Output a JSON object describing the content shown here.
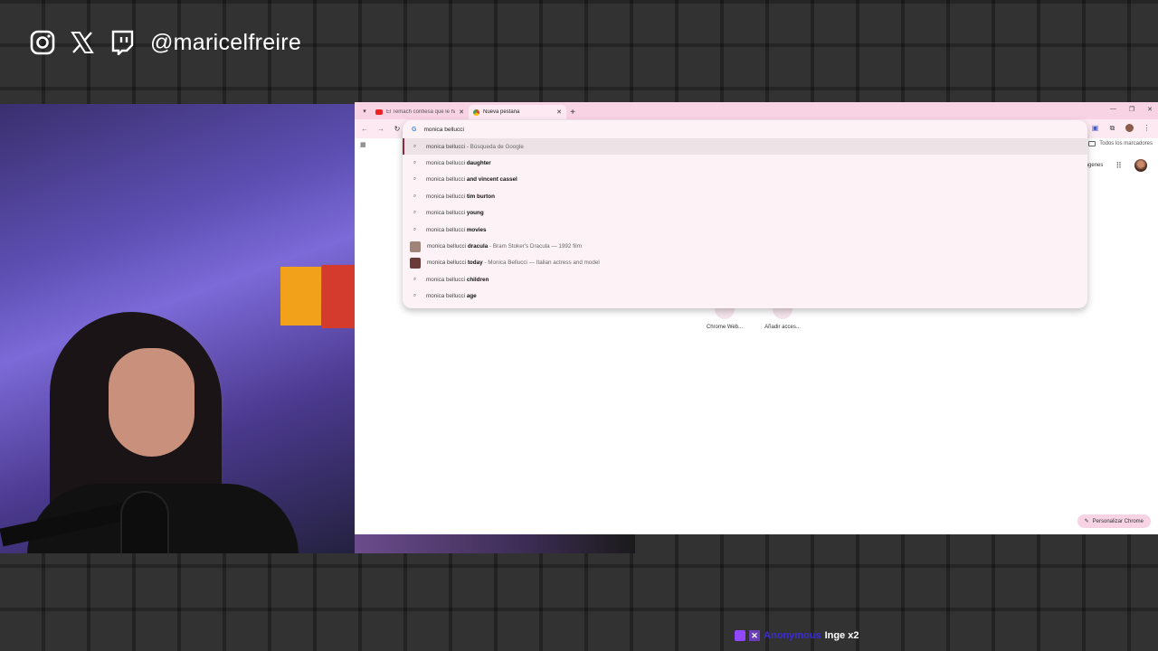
{
  "social": {
    "handle": "@maricelfreire",
    "icons": [
      "instagram-icon",
      "x-icon",
      "twitch-icon"
    ]
  },
  "browser": {
    "tabs": [
      {
        "title": "El Temach confiesa que le han...",
        "active": false
      },
      {
        "title": "Nueva pestaña",
        "active": true
      }
    ],
    "omnibox_value": "monica bellucci",
    "bookmarks_all": "Todos los marcadores",
    "images_link": "Imágenes",
    "suggestions": [
      {
        "base": "monica bellucci",
        "bold": "",
        "sub": " - Búsqueda de Google"
      },
      {
        "base": "monica bellucci ",
        "bold": "daughter",
        "sub": ""
      },
      {
        "base": "monica bellucci ",
        "bold": "and vincent cassel",
        "sub": ""
      },
      {
        "base": "monica bellucci ",
        "bold": "tim burton",
        "sub": ""
      },
      {
        "base": "monica bellucci ",
        "bold": "young",
        "sub": ""
      },
      {
        "base": "monica bellucci ",
        "bold": "movies",
        "sub": ""
      },
      {
        "base": "monica bellucci ",
        "bold": "dracula",
        "sub": " - Bram Stoker's Dracula — 1992 film"
      },
      {
        "base": "monica bellucci ",
        "bold": "today",
        "sub": " - Monica Bellucci — Italian actress and model"
      },
      {
        "base": "monica bellucci ",
        "bold": "children",
        "sub": ""
      },
      {
        "base": "monica bellucci ",
        "bold": "age",
        "sub": ""
      }
    ],
    "shortcuts": [
      "Chrome Web...",
      "Añadir acces..."
    ],
    "customize_label": "Personalizar Chrome"
  },
  "alert": {
    "user": "Anonymous",
    "text": "Inge x2"
  },
  "colors": {
    "tabbar": "#f8d3e4",
    "toolbar": "#fce9f1",
    "selection_bar": "#8b2a45"
  }
}
